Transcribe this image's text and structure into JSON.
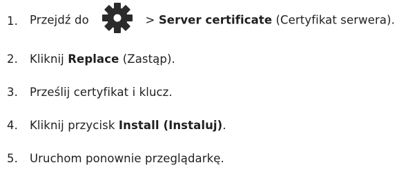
{
  "steps": [
    {
      "number": "1.",
      "text_before": "Przejdź do",
      "icon": "gear-icon",
      "separator": ">",
      "bold": "Server certificate",
      "text_after": "(Certyfikat serwera)."
    },
    {
      "number": "2.",
      "text_before": "Kliknij",
      "bold": "Replace",
      "text_after": "(Zastąp)."
    },
    {
      "number": "3.",
      "text": "Prześlij certyfikat i klucz."
    },
    {
      "number": "4.",
      "text_before": "Kliknij przycisk",
      "bold": "Install (Instaluj)",
      "text_after": "."
    },
    {
      "number": "5.",
      "text": "Uruchom ponownie przeglądarkę."
    }
  ]
}
